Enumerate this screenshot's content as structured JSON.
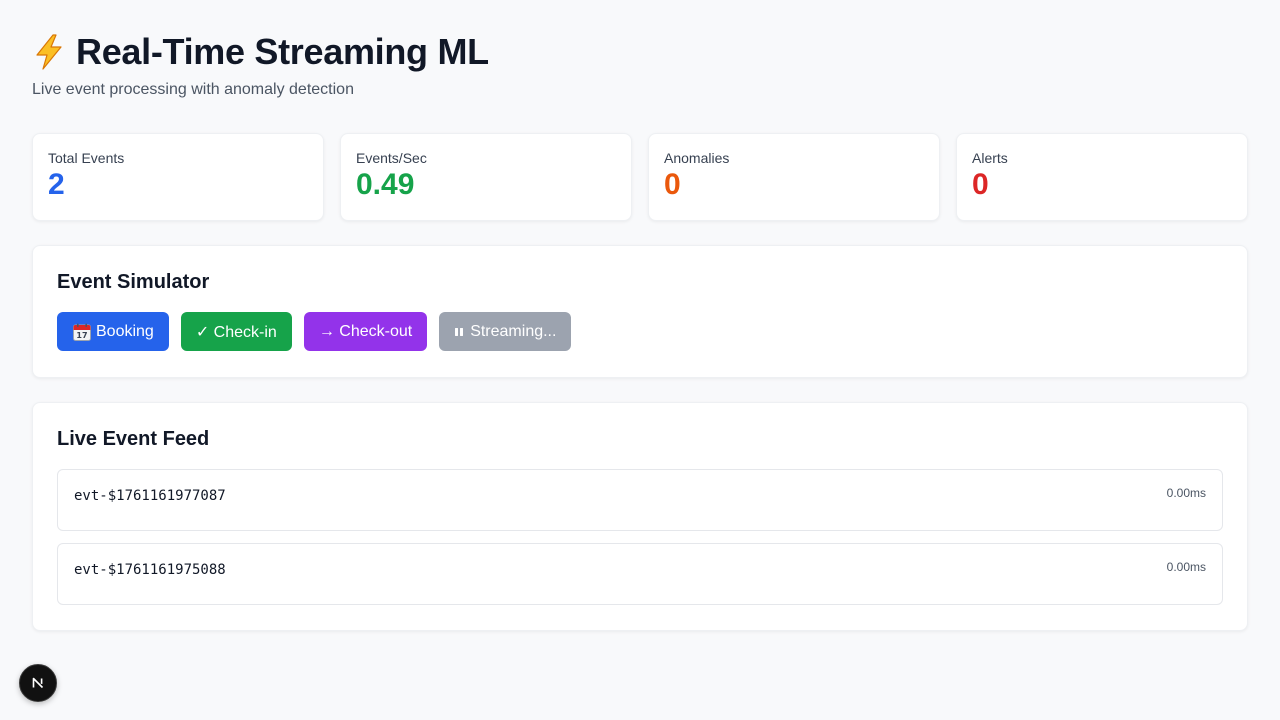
{
  "header": {
    "icon": "lightning-bolt-icon",
    "title": "Real-Time Streaming ML",
    "subtitle": "Live event processing with anomaly detection"
  },
  "stats": [
    {
      "label": "Total Events",
      "value": "2",
      "color": "#2563eb"
    },
    {
      "label": "Events/Sec",
      "value": "0.49",
      "color": "#16a34a"
    },
    {
      "label": "Anomalies",
      "value": "0",
      "color": "#ea580c"
    },
    {
      "label": "Alerts",
      "value": "0",
      "color": "#dc2626"
    }
  ],
  "simulator": {
    "title": "Event Simulator",
    "buttons": {
      "booking": {
        "icon": "calendar-icon",
        "label": "Booking",
        "color": "#2563eb"
      },
      "checkin": {
        "icon": "checkmark-icon",
        "label": "✓ Check-in",
        "color": "#16a34a"
      },
      "checkout": {
        "icon": "arrow-right-icon",
        "label": "→ Check-out",
        "color": "#9333ea"
      },
      "streaming": {
        "icon": "pause-icon",
        "label": "Streaming...",
        "color": "#9ca3af"
      }
    }
  },
  "feed": {
    "title": "Live Event Feed",
    "events": [
      {
        "id": "evt-$1761161977087",
        "latency": "0.00ms"
      },
      {
        "id": "evt-$1761161975088",
        "latency": "0.00ms"
      }
    ]
  },
  "overlay": {
    "badge_icon": "nextjs-logo-icon"
  }
}
